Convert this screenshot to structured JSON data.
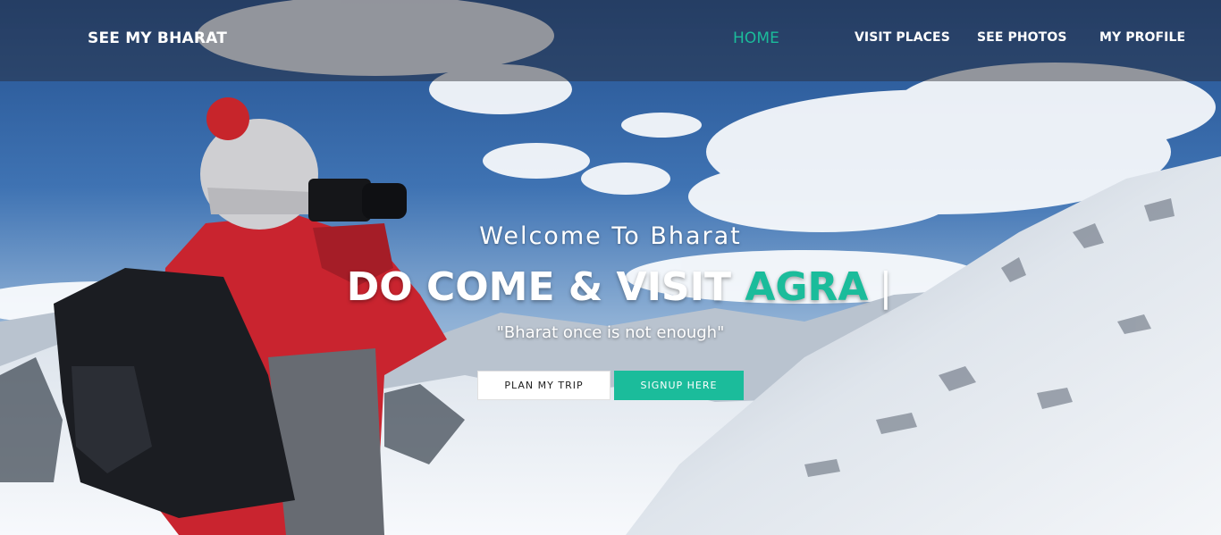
{
  "nav": {
    "brand": "SEE MY BHARAT",
    "links": [
      {
        "label": "HOME",
        "active": true
      },
      {
        "label": "VISIT PLACES",
        "active": false
      },
      {
        "label": "SEE PHOTOS",
        "active": false
      },
      {
        "label": "MY PROFILE",
        "active": false
      }
    ]
  },
  "hero": {
    "welcome": "Welcome To Bharat",
    "headline_prefix": "DO COME & VISIT",
    "headline_accent": "AGRA",
    "headline_cursor": "|",
    "tagline": "\"Bharat once is not enough\"",
    "buttons": {
      "plan": "PLAN MY TRIP",
      "signup": "SIGNUP HERE"
    }
  },
  "colors": {
    "accent": "#1bbc9b",
    "nav_overlay": "rgba(40,40,48,0.45)",
    "text": "#ffffff"
  },
  "background": {
    "description_icon": "mountain-photographer-hero-image"
  }
}
